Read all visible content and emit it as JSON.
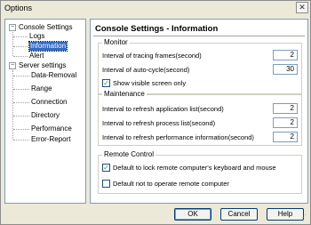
{
  "window": {
    "title": "Options",
    "close_glyph": "✕"
  },
  "tree": {
    "groups": [
      {
        "label": "Console Settings",
        "expander": "−",
        "children": [
          "Logs",
          "Information",
          "Alert"
        ]
      },
      {
        "label": "Server settings",
        "expander": "−",
        "children": [
          "Data-Removal",
          "Range",
          "Connection",
          "Directory",
          "Performance",
          "Error-Report"
        ]
      }
    ],
    "selected": "Information"
  },
  "panel": {
    "title": "Console Settings - Information",
    "monitor": {
      "title": "Monitor",
      "tracing_label": "Interval of tracing frames(second)",
      "tracing_value": "2",
      "autocycle_label": "Interval of auto-cycle(second)",
      "autocycle_value": "30",
      "visible_label": "Show visible screen only",
      "visible_checked": "✓"
    },
    "maintenance": {
      "title": "Maintenance",
      "app_label": "Interval to refresh application list(second)",
      "app_value": "2",
      "process_label": "Interval to refresh process list(second)",
      "process_value": "2",
      "perf_label": "Interval to refresh performance information(second)",
      "perf_value": "2"
    },
    "remote": {
      "title": "Remote Control",
      "lock_label": "Default to lock remote computer's keyboard and mouse",
      "lock_checked": "✓",
      "nooperate_label": "Default not to operate remote computer",
      "nooperate_checked": ""
    }
  },
  "buttons": {
    "ok": "OK",
    "cancel": "Cancel",
    "help": "Help"
  },
  "icons": {
    "resize_grip": "resize-grip-icon"
  }
}
